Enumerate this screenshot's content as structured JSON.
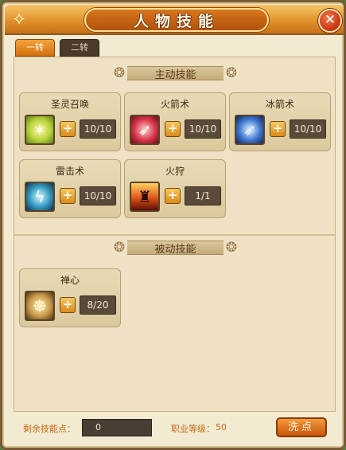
{
  "window": {
    "title": "人物技能",
    "close_icon": "close-icon"
  },
  "tabs": [
    {
      "label": "一转",
      "active": true
    },
    {
      "label": "二转",
      "active": false
    }
  ],
  "active_section": {
    "title": "主动技能",
    "skills": [
      {
        "name": "圣灵召唤",
        "icon": "summon-spirit-icon",
        "level": "10/10"
      },
      {
        "name": "火箭术",
        "icon": "fire-arrow-icon",
        "level": "10/10"
      },
      {
        "name": "冰箭术",
        "icon": "ice-arrow-icon",
        "level": "10/10"
      },
      {
        "name": "雷击术",
        "icon": "thunder-strike-icon",
        "level": "10/10"
      },
      {
        "name": "火狩",
        "icon": "fire-hunt-icon",
        "level": "1/1"
      }
    ]
  },
  "passive_section": {
    "title": "被动技能",
    "skills": [
      {
        "name": "禅心",
        "icon": "zen-mind-icon",
        "level": "8/20"
      }
    ]
  },
  "footer": {
    "remaining_points_label": "剩余技能点：",
    "remaining_points_value": "0",
    "job_level_label": "职业等级：",
    "job_level_value": "50",
    "reset_button": "洗点"
  }
}
